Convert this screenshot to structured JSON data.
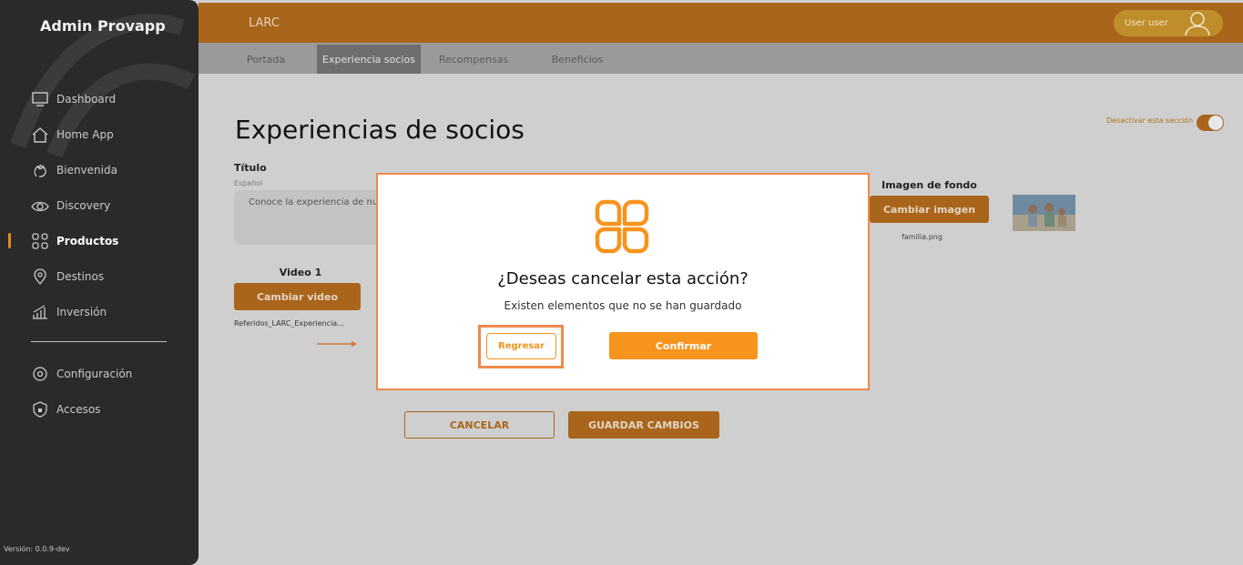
{
  "sidebar": {
    "brand": "Admin Provapp",
    "items": [
      {
        "label": "Dashboard",
        "icon": "monitor-icon"
      },
      {
        "label": "Home App",
        "icon": "home-icon"
      },
      {
        "label": "Bienvenida",
        "icon": "wave-hand-icon"
      },
      {
        "label": "Discovery",
        "icon": "eye-icon"
      },
      {
        "label": "Productos",
        "icon": "grid-icon",
        "active": true
      },
      {
        "label": "Destinos",
        "icon": "location-pin-icon"
      },
      {
        "label": "Inversión",
        "icon": "bar-chart-icon"
      }
    ],
    "items2": [
      {
        "label": "Configuración",
        "icon": "settings-icon"
      },
      {
        "label": "Accesos",
        "icon": "shield-icon"
      }
    ],
    "version": "Versión: 0.0.9-dev"
  },
  "topbar": {
    "app_name": "LARC",
    "user": "User user"
  },
  "tabs": [
    {
      "label": "Portada"
    },
    {
      "label": "Experiencia socios",
      "active": true
    },
    {
      "label": "Recompensas"
    },
    {
      "label": "Beneficios"
    }
  ],
  "page": {
    "title": "Experiencias de socios",
    "toggle_label": "Desactivar esta sección",
    "toggle_on": true,
    "titulo_label": "Título",
    "lang_label": "Español",
    "titulo_value": "Conoce la experiencia de nu",
    "video_label": "Video 1",
    "video_button": "Cambiar video",
    "video_file": "Referidos_LARC_Experiencia...",
    "image_label": "Imagen de fondo",
    "image_button": "Cambiar imagen",
    "image_file": "familia.png",
    "cancel_button": "CANCELAR",
    "save_button": "GUARDAR CAMBIOS"
  },
  "modal": {
    "title": "¿Deseas cancelar esta acción?",
    "subtitle": "Existen elementos que no se han guardado",
    "back_button": "Regresar",
    "confirm_button": "Confirmar"
  },
  "colors": {
    "accent": "#f7941d",
    "accent_dim": "#a9651b",
    "sidebar_bg": "#2a2a2a",
    "highlight": "#f0894a"
  }
}
